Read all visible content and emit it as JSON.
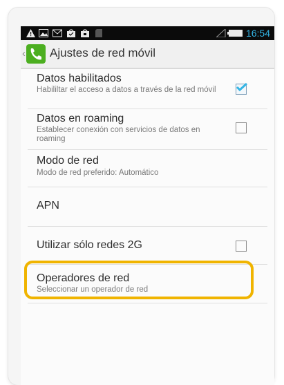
{
  "status_bar": {
    "time": "16:54",
    "icons": [
      "warning-icon",
      "image-icon",
      "mail-icon",
      "shopping-bag-icon",
      "shopping-bag-icon-2",
      "sd-card-icon",
      "signal-icon",
      "battery-icon"
    ]
  },
  "action_bar": {
    "title": "Ajustes de red móvil"
  },
  "settings": {
    "items": [
      {
        "title": "Datos habilitados",
        "subtitle": "Habililtar el acceso a datos a través de la red móvil",
        "checked": true
      },
      {
        "title": "Datos en roaming",
        "subtitle": "Establecer conexión con servicios de datos en roaming",
        "checked": false
      },
      {
        "title": "Modo de red",
        "subtitle": "Modo de red preferido: Automático"
      },
      {
        "title": "APN"
      },
      {
        "title": "Utilizar sólo redes 2G",
        "checked": false
      },
      {
        "title": "Operadores de red",
        "subtitle": "Seleccionar un operador de red"
      }
    ]
  },
  "colors": {
    "accent": "#33b5e5",
    "highlight": "#f0b400",
    "app_icon": "#4caf20"
  }
}
